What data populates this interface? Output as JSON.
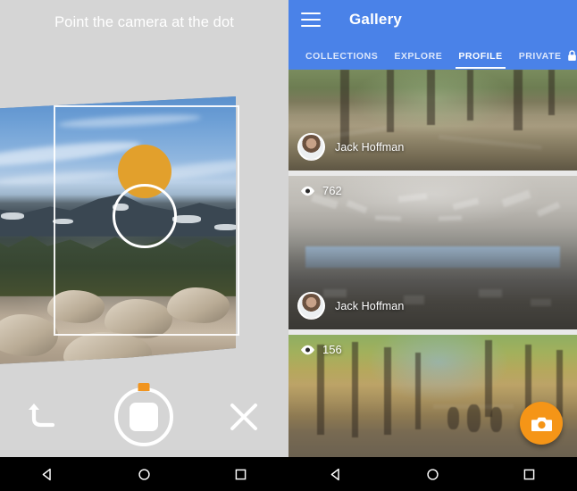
{
  "left_screen": {
    "name": "camera-capture-screen",
    "hint_text": "Point the camera at the dot",
    "background_color": "#d5d5d5",
    "target_dot_color": "#e2a02c",
    "controls": {
      "undo_label": "Undo",
      "shutter_label": "Stop capture",
      "close_label": "Close",
      "progress_marker_color": "#f0941f"
    }
  },
  "right_screen": {
    "name": "gallery-screen",
    "appbar": {
      "title": "Gallery",
      "color": "#4a82e8",
      "menu_label": "Menu"
    },
    "tabs": [
      {
        "label": "COLLECTIONS",
        "active": false
      },
      {
        "label": "EXPLORE",
        "active": false
      },
      {
        "label": "PROFILE",
        "active": true
      },
      {
        "label": "PRIVATE",
        "active": false,
        "icon": "lock-icon"
      }
    ],
    "cards": [
      {
        "id": "card-forest-path",
        "author": "Jack Hoffman",
        "views": "",
        "scene": "forest dirt path panorama"
      },
      {
        "id": "card-office-interior",
        "author": "Jack Hoffman",
        "views": "762",
        "scene": "office cafeteria interior panorama"
      },
      {
        "id": "card-autumn-trail",
        "author": "",
        "views": "156",
        "scene": "autumn bike trail panorama"
      }
    ],
    "fab": {
      "label": "Capture photo",
      "color": "#f59517",
      "icon": "camera-icon"
    }
  },
  "navbar": {
    "back_label": "Back",
    "home_label": "Home",
    "recents_label": "Recent apps"
  }
}
